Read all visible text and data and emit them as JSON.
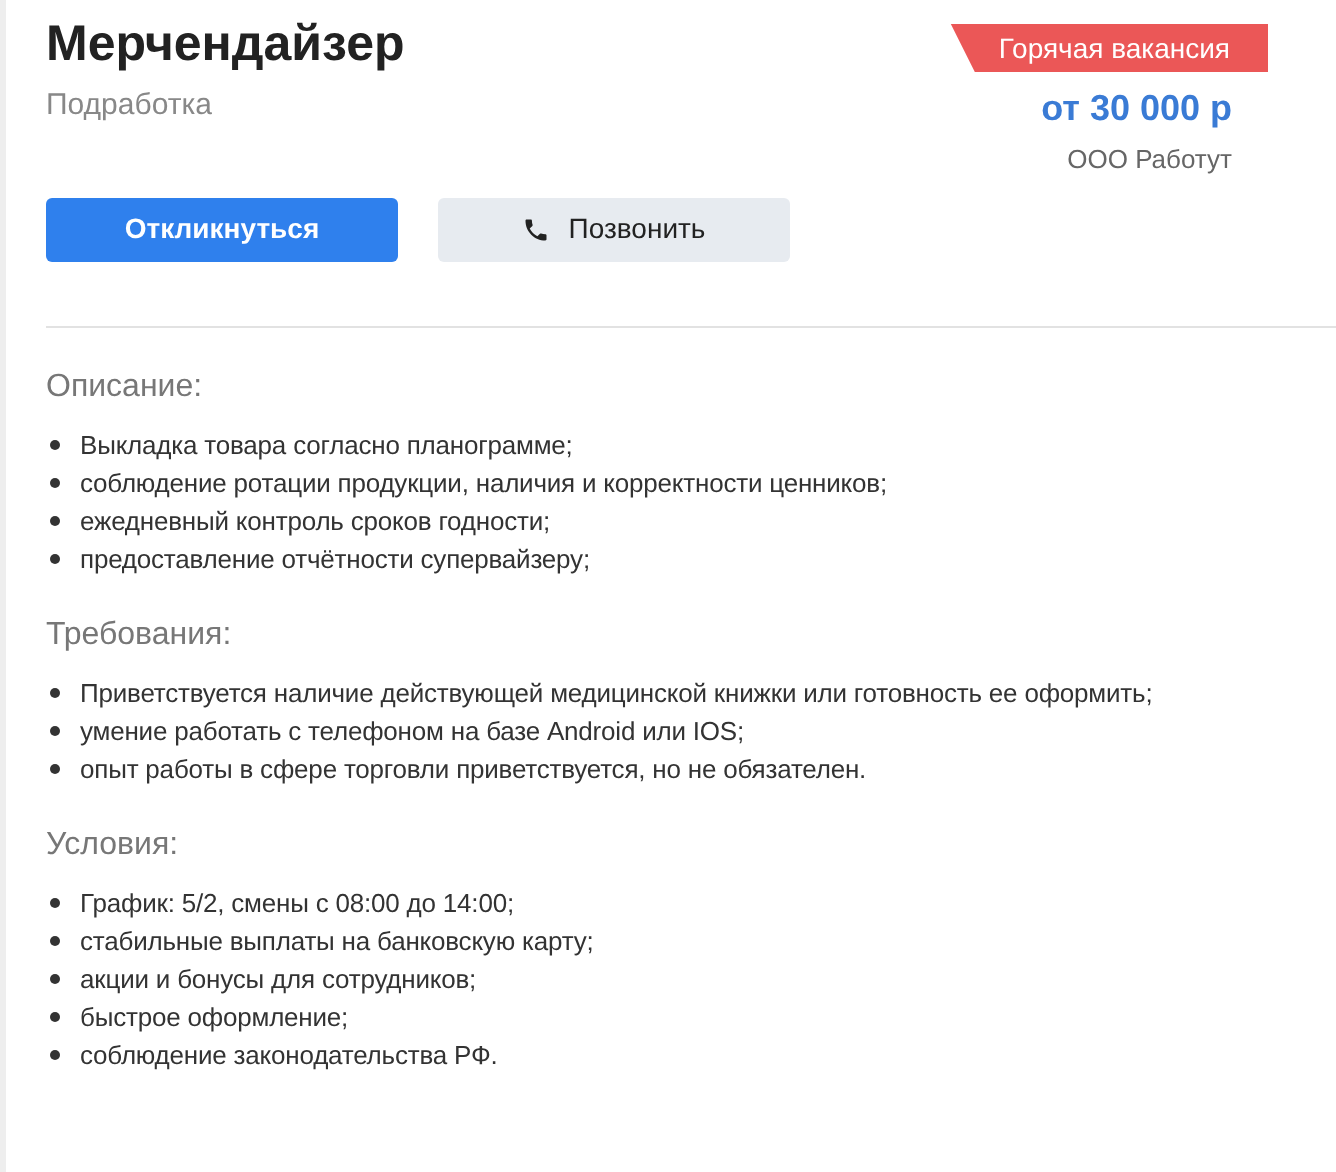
{
  "title": "Мерчендайзер",
  "subtitle": "Подработка",
  "badge": "Горячая вакансия",
  "salary": "от 30 000 р",
  "company": "ООО Работут",
  "buttons": [
    {
      "label": "Откликнуться",
      "kind": "primary"
    },
    {
      "label": "Позвонить",
      "kind": "phone"
    }
  ],
  "sections": [
    {
      "heading": "Описание:",
      "items": [
        "Выкладка товара согласно планограмме;",
        "соблюдение ротации продукции, наличия и корректности ценников;",
        "ежедневный контроль сроков годности;",
        "предоставление отчётности супервайзеру;"
      ]
    },
    {
      "heading": "Требования:",
      "items": [
        "Приветствуется наличие действующей медицинской книжки или готовность ее оформить;",
        "умение работать с телефоном на базе Android или IOS;",
        "опыт работы в сфере торговли приветствуется, но не обязателен."
      ]
    },
    {
      "heading": "Условия:",
      "items": [
        "График: 5/2, смены с 08:00 до 14:00;",
        "стабильные выплаты на банковскую карту;",
        "акции и бонусы для сотрудников;",
        "быстрое оформление;",
        "соблюдение законодательства РФ."
      ]
    }
  ]
}
